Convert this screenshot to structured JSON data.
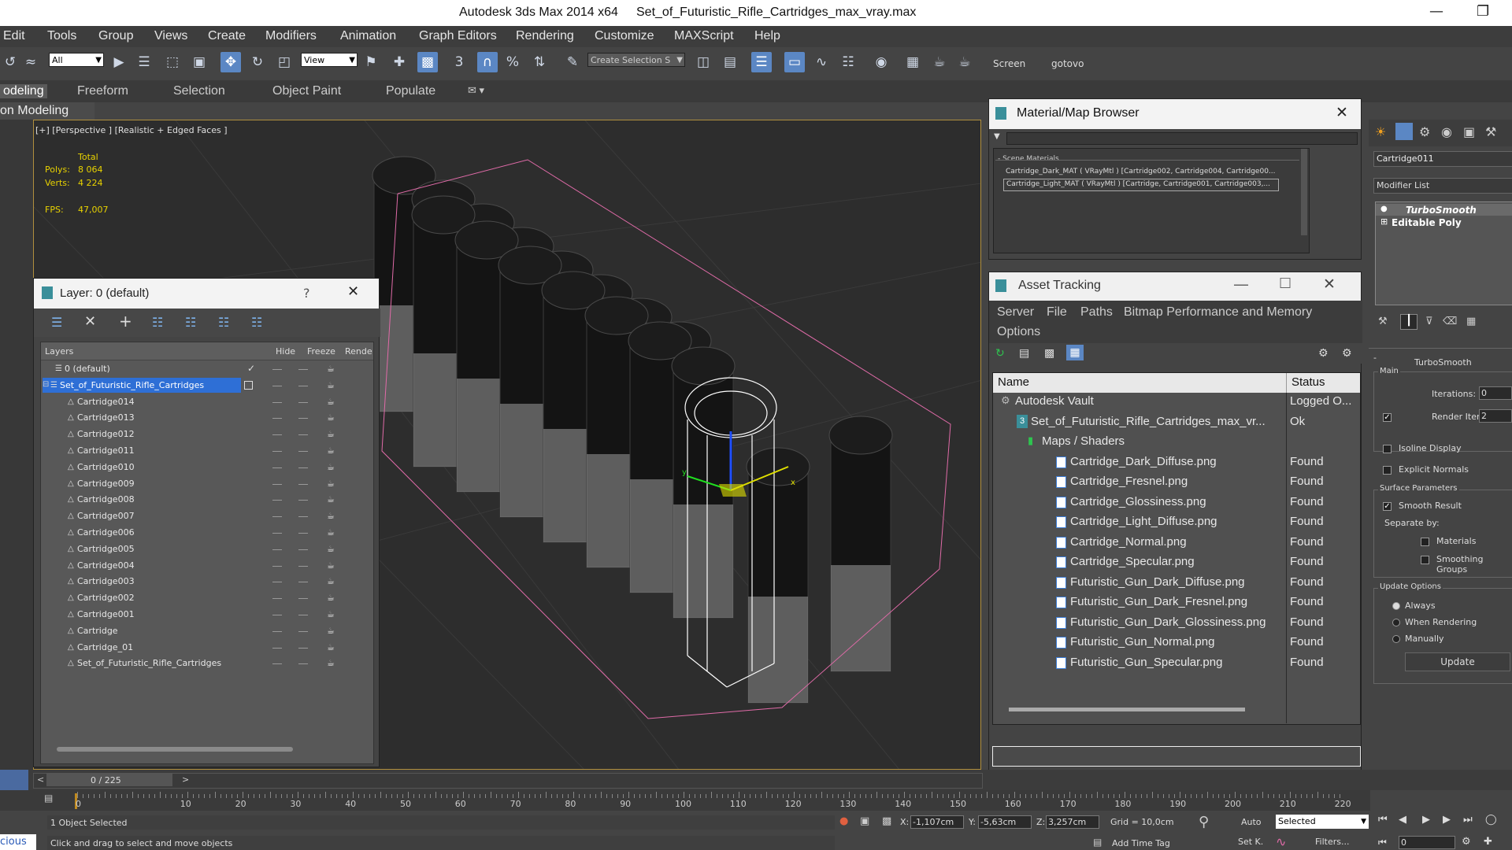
{
  "title_bar": {
    "app": "Autodesk 3ds Max  2014 x64",
    "file": "Set_of_Futuristic_Rifle_Cartridges_max_vray.max"
  },
  "menu": [
    "Edit",
    "Tools",
    "Group",
    "Views",
    "Create",
    "Modifiers",
    "Animation",
    "Graph Editors",
    "Rendering",
    "Customize",
    "MAXScript",
    "Help"
  ],
  "toolbar": {
    "selection_filter": "All",
    "ref_coord": "View",
    "named_selection": "Create Selection S",
    "screen_label": "Screen",
    "gotovo_label": "gotovo",
    "snap_3": "3",
    "snap_2": "2"
  },
  "ribbon": {
    "tabs": [
      "odeling",
      "Freeform",
      "Selection",
      "Object Paint",
      "Populate"
    ],
    "sub": "on Modeling"
  },
  "viewport": {
    "label": "[+] [Perspective ] [Realistic + Edged Faces ]",
    "stats": {
      "total_label": "Total",
      "polys_label": "Polys:",
      "polys_value": "8 064",
      "verts_label": "Verts:",
      "verts_value": "4 224",
      "fps_label": "FPS:",
      "fps_value": "47,007"
    },
    "gizmo": {
      "x": "x",
      "y": "y"
    }
  },
  "layer_window": {
    "title": "Layer: 0 (default)",
    "help": "?",
    "columns": {
      "layers": "Layers",
      "hide": "Hide",
      "freeze": "Freeze",
      "render": "Rende"
    },
    "rows": [
      {
        "name": "0 (default)"
      },
      {
        "name": "Set_of_Futuristic_Rifle_Cartridges"
      },
      {
        "name": "Cartridge014"
      },
      {
        "name": "Cartridge013"
      },
      {
        "name": "Cartridge012"
      },
      {
        "name": "Cartridge011"
      },
      {
        "name": "Cartridge010"
      },
      {
        "name": "Cartridge009"
      },
      {
        "name": "Cartridge008"
      },
      {
        "name": "Cartridge007"
      },
      {
        "name": "Cartridge006"
      },
      {
        "name": "Cartridge005"
      },
      {
        "name": "Cartridge004"
      },
      {
        "name": "Cartridge003"
      },
      {
        "name": "Cartridge002"
      },
      {
        "name": "Cartridge001"
      },
      {
        "name": "Cartridge"
      },
      {
        "name": "Cartridge_01"
      },
      {
        "name": "Set_of_Futuristic_Rifle_Cartridges"
      }
    ]
  },
  "material_browser": {
    "title": "Material/Map Browser",
    "section": "- Scene Materials",
    "items": [
      "Cartridge_Dark_MAT ( VRayMtl ) [Cartridge002, Cartridge004, Cartridge00...",
      "Cartridge_Light_MAT ( VRayMtl ) [Cartridge, Cartridge001, Cartridge003,..."
    ]
  },
  "asset_tracking": {
    "title": "Asset Tracking",
    "menu": [
      "Server",
      "File",
      "Paths",
      "Bitmap Performance and Memory",
      "Options"
    ],
    "columns": {
      "name": "Name",
      "status": "Status"
    },
    "rows": [
      {
        "name": "Autodesk Vault",
        "status": "Logged O..."
      },
      {
        "name": "Set_of_Futuristic_Rifle_Cartridges_max_vr...",
        "status": "Ok"
      },
      {
        "name": "Maps / Shaders",
        "status": ""
      },
      {
        "name": "Cartridge_Dark_Diffuse.png",
        "status": "Found"
      },
      {
        "name": "Cartridge_Fresnel.png",
        "status": "Found"
      },
      {
        "name": "Cartridge_Glossiness.png",
        "status": "Found"
      },
      {
        "name": "Cartridge_Light_Diffuse.png",
        "status": "Found"
      },
      {
        "name": "Cartridge_Normal.png",
        "status": "Found"
      },
      {
        "name": "Cartridge_Specular.png",
        "status": "Found"
      },
      {
        "name": "Futuristic_Gun_Dark_Diffuse.png",
        "status": "Found"
      },
      {
        "name": "Futuristic_Gun_Dark_Fresnel.png",
        "status": "Found"
      },
      {
        "name": "Futuristic_Gun_Dark_Glossiness.png",
        "status": "Found"
      },
      {
        "name": "Futuristic_Gun_Normal.png",
        "status": "Found"
      },
      {
        "name": "Futuristic_Gun_Specular.png",
        "status": "Found"
      }
    ]
  },
  "command_panel": {
    "object_name": "Cartridge011",
    "modifier_list": "Modifier List",
    "stack": [
      "TurboSmooth",
      "Editable Poly"
    ],
    "rollout_title": "TurboSmooth",
    "main": {
      "group": "Main",
      "iterations_label": "Iterations:",
      "iterations_value": "0",
      "render_iters_label": "Render Iters:",
      "render_iters_value": "2",
      "isoline": "Isoline Display",
      "explicit_normals": "Explicit Normals"
    },
    "surface": {
      "group": "Surface Parameters",
      "smooth_result": "Smooth Result",
      "separate_by": "Separate by:",
      "materials": "Materials",
      "smoothing_groups": "Smoothing Groups"
    },
    "update": {
      "group": "Update Options",
      "always": "Always",
      "when_rendering": "When Rendering",
      "manually": "Manually",
      "button": "Update"
    }
  },
  "timeline": {
    "frame": "0 / 225",
    "ticks": [
      "0",
      "10",
      "20",
      "30",
      "40",
      "50",
      "60",
      "70",
      "80",
      "90",
      "100",
      "110",
      "120",
      "130",
      "140",
      "150",
      "160",
      "170",
      "180",
      "190",
      "200",
      "210",
      "220"
    ]
  },
  "status": {
    "selected": "1 Object Selected",
    "prompt": "Click and drag to select and move objects",
    "x_label": "X:",
    "x_value": "-1,107cm",
    "y_label": "Y:",
    "y_value": "-5,63cm",
    "z_label": "Z:",
    "z_value": "3,257cm",
    "grid": "Grid = 10,0cm",
    "add_time_tag": "Add Time Tag",
    "auto": "Auto",
    "selected_combo": "Selected",
    "setk": "Set K.",
    "filters": "Filters...",
    "frame_field": "0",
    "script_tab": "cious"
  }
}
